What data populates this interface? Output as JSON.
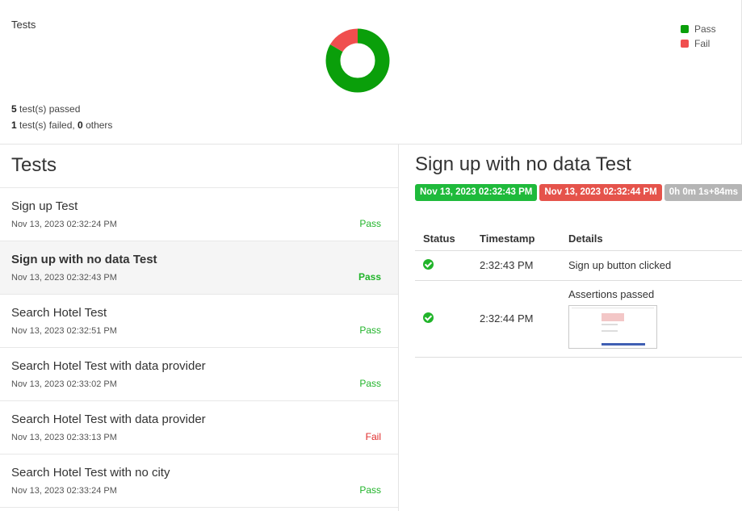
{
  "summary": {
    "title": "Tests",
    "chart": {
      "pass_count": 5,
      "fail_count": 1,
      "pass_color": "#0a9f0a",
      "fail_color": "#f04e4e"
    },
    "legend": [
      {
        "label": "Pass",
        "color": "#0a9f0a"
      },
      {
        "label": "Fail",
        "color": "#f04e4e"
      }
    ],
    "passed_count": "5",
    "passed_text": " test(s) passed",
    "failed_count": "1",
    "failed_text": " test(s) failed, ",
    "others_count": "0",
    "others_text": " others"
  },
  "list": {
    "title": "Tests",
    "items": [
      {
        "name": "Sign up Test",
        "time": "Nov 13, 2023 02:32:24 PM",
        "status": "Pass"
      },
      {
        "name": "Sign up with no data Test",
        "time": "Nov 13, 2023 02:32:43 PM",
        "status": "Pass"
      },
      {
        "name": "Search Hotel Test",
        "time": "Nov 13, 2023 02:32:51 PM",
        "status": "Pass"
      },
      {
        "name": "Search Hotel Test with data provider",
        "time": "Nov 13, 2023 02:33:02 PM",
        "status": "Pass"
      },
      {
        "name": "Search Hotel Test with data provider",
        "time": "Nov 13, 2023 02:33:13 PM",
        "status": "Fail"
      },
      {
        "name": "Search Hotel Test with no city",
        "time": "Nov 13, 2023 02:33:24 PM",
        "status": "Pass"
      }
    ]
  },
  "detail": {
    "title": "Sign up with no data Test",
    "start_time": "Nov 13, 2023 02:32:43 PM",
    "end_time": "Nov 13, 2023 02:32:44 PM",
    "duration": "0h 0m 1s+84ms",
    "columns": [
      "Status",
      "Timestamp",
      "Details"
    ],
    "logs": [
      {
        "timestamp": "2:32:43 PM",
        "details": "Sign up button clicked"
      },
      {
        "timestamp": "2:32:44 PM",
        "details": "Assertions passed"
      }
    ]
  }
}
